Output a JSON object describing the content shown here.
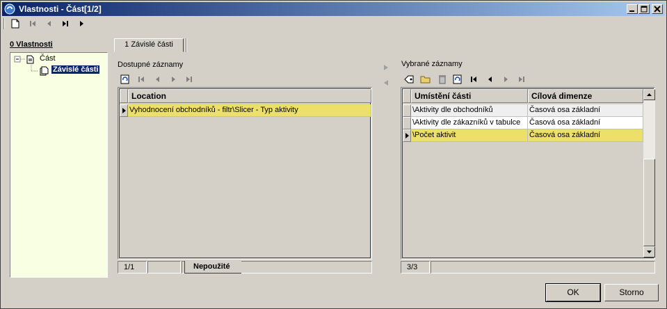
{
  "window": {
    "title": "Vlastnosti - Část[1/2]"
  },
  "left": {
    "label": "0 Vlastnosti",
    "tree": [
      {
        "label": "Část"
      },
      {
        "label": "Závislé části"
      }
    ]
  },
  "tabs": [
    {
      "label": "1 Závislé části"
    }
  ],
  "available": {
    "label": "Dostupné záznamy",
    "columns": [
      "Location"
    ],
    "rows": [
      [
        "Vyhodnocení obchodníků - filtr\\Slicer - Typ aktivity"
      ]
    ],
    "status": "1/1",
    "status_tab": "Nepoužité"
  },
  "selected": {
    "label": "Vybrané záznamy",
    "columns": [
      "Umístění části",
      "Cílová dimenze"
    ],
    "rows": [
      [
        "\\Aktivity dle obchodníků",
        "Časová osa základní"
      ],
      [
        "\\Aktivity dle zákazníků v tabulce",
        "Časová osa základní"
      ],
      [
        "\\Počet aktivit",
        "Časová osa základní"
      ]
    ],
    "status": "3/3"
  },
  "buttons": {
    "ok": "OK",
    "cancel": "Storno"
  },
  "colors": {
    "selection": "#ede06a",
    "title_start": "#0a246a",
    "title_end": "#a6caf0",
    "tree_bg": "#f9ffe2"
  }
}
